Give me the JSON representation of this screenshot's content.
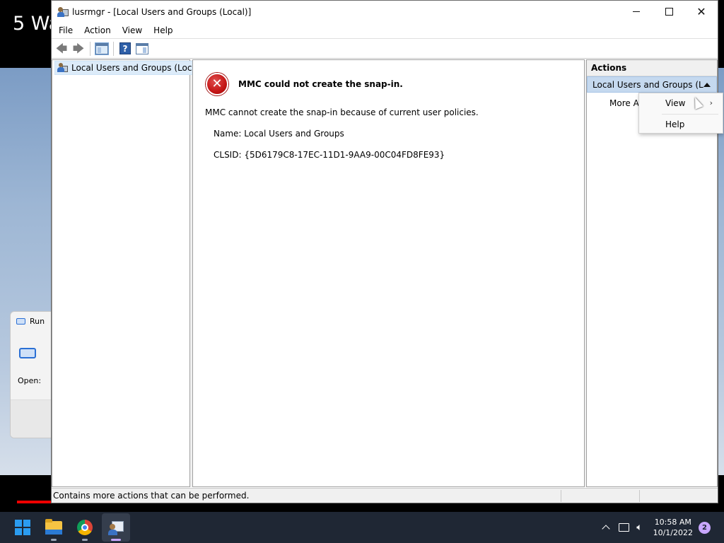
{
  "video": {
    "title": "5 Wa"
  },
  "run_dialog": {
    "title": "Run",
    "open_label": "Open:"
  },
  "window": {
    "title": "lusrmgr - [Local Users and Groups (Local)]"
  },
  "menu": [
    "File",
    "Action",
    "View",
    "Help"
  ],
  "tree": {
    "root_label": "Local Users and Groups (Local)"
  },
  "error": {
    "title": "MMC could not create the snap-in.",
    "description": "MMC cannot create the snap-in because of current user policies.",
    "name_line": "Name: Local Users and Groups",
    "clsid_line": "CLSID: {5D6179C8-17EC-11D1-9AA9-00C04FD8FE93}"
  },
  "actions": {
    "header": "Actions",
    "group_label": "Local Users and Groups (Lo...",
    "more_actions": "More Actions"
  },
  "context_menu": {
    "view": "View",
    "help": "Help"
  },
  "status": {
    "text": "Contains more actions that can be performed."
  },
  "taskbar": {
    "clock_time": "10:58 AM",
    "clock_date": "10/1/2022",
    "notification_count": "2"
  },
  "colors": {
    "accent": "#c5d9ef",
    "error_red": "#c41414",
    "taskbar_bg": "#1f2734"
  }
}
